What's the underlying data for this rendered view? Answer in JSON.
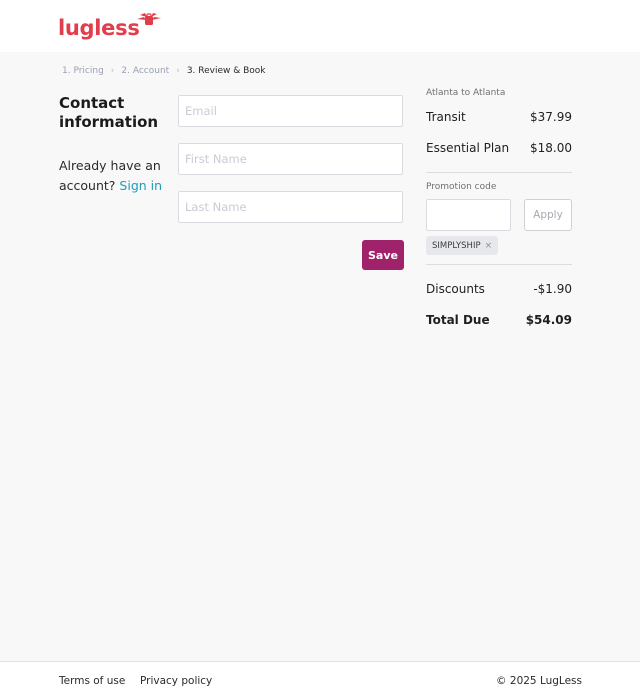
{
  "brand": {
    "name": "lugless",
    "color": "#e23d4b"
  },
  "breadcrumb": [
    {
      "label": "1. Pricing"
    },
    {
      "label": "2. Account"
    },
    {
      "label": "3. Review & Book"
    }
  ],
  "contact": {
    "title": "Contact information",
    "signin_prefix": "Already have an account?",
    "signin_link": "Sign in",
    "email_placeholder": "Email",
    "first_name_placeholder": "First Name",
    "last_name_placeholder": "Last Name",
    "email_value": "",
    "first_name_value": "",
    "last_name_value": "",
    "save_label": "Save"
  },
  "summary": {
    "route": "Atlanta to Atlanta",
    "items": [
      {
        "label": "Transit",
        "amount": "$37.99"
      },
      {
        "label": "Essential Plan",
        "amount": "$18.00"
      }
    ],
    "promo_label": "Promotion code",
    "promo_value": "",
    "apply_label": "Apply",
    "applied_code": "SIMPLYSHIP",
    "discount_label": "Discounts",
    "discount_amount": "-$1.90",
    "total_label": "Total Due",
    "total_amount": "$54.09"
  },
  "footer": {
    "terms": "Terms of use",
    "privacy": "Privacy policy",
    "copyright": "© 2025 LugLess"
  },
  "colors": {
    "accent": "#a0226b",
    "link": "#1a9fb8"
  }
}
